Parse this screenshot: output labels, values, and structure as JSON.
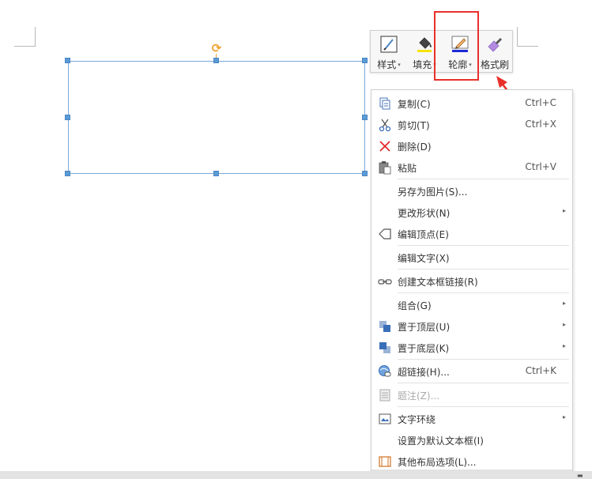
{
  "toolbar": {
    "items": [
      {
        "label": "样式",
        "caret": "▾",
        "icon": "style-icon"
      },
      {
        "label": "填充",
        "caret": "▾",
        "icon": "fill-bucket-icon"
      },
      {
        "label": "轮廓",
        "caret": "▾",
        "icon": "pencil-outline-icon"
      },
      {
        "label": "格式刷",
        "caret": "",
        "icon": "format-brush-icon"
      }
    ],
    "colors": {
      "fill_bar": "#f5e400",
      "outline_bar": "#1a2bd6",
      "brush": "#b28ae0"
    }
  },
  "annotation": {
    "highlight_color": "#e8302a"
  },
  "context_menu": {
    "items": [
      {
        "label": "复制(C)",
        "shortcut": "Ctrl+C",
        "icon": "copy-icon",
        "submenu": false,
        "disabled": false
      },
      {
        "label": "剪切(T)",
        "shortcut": "Ctrl+X",
        "icon": "scissors-icon",
        "submenu": false,
        "disabled": false
      },
      {
        "label": "删除(D)",
        "shortcut": "",
        "icon": "delete-x-icon",
        "submenu": false,
        "disabled": false
      },
      {
        "label": "粘贴",
        "shortcut": "Ctrl+V",
        "icon": "paste-icon",
        "submenu": false,
        "disabled": false
      },
      {
        "label": "另存为图片(S)...",
        "shortcut": "",
        "icon": "",
        "submenu": false,
        "disabled": false
      },
      {
        "label": "更改形状(N)",
        "shortcut": "",
        "icon": "",
        "submenu": true,
        "disabled": false
      },
      {
        "label": "编辑顶点(E)",
        "shortcut": "",
        "icon": "edit-points-icon",
        "submenu": false,
        "disabled": false
      },
      {
        "label": "编辑文字(X)",
        "shortcut": "",
        "icon": "",
        "submenu": false,
        "disabled": false
      },
      {
        "label": "创建文本框链接(R)",
        "shortcut": "",
        "icon": "link-chain-icon",
        "submenu": false,
        "disabled": false
      },
      {
        "label": "组合(G)",
        "shortcut": "",
        "icon": "",
        "submenu": true,
        "disabled": false
      },
      {
        "label": "置于顶层(U)",
        "shortcut": "",
        "icon": "bring-to-front-icon",
        "submenu": true,
        "disabled": false
      },
      {
        "label": "置于底层(K)",
        "shortcut": "",
        "icon": "send-to-back-icon",
        "submenu": true,
        "disabled": false
      },
      {
        "label": "超链接(H)...",
        "shortcut": "Ctrl+K",
        "icon": "hyperlink-globe-icon",
        "submenu": false,
        "disabled": false
      },
      {
        "label": "题注(Z)...",
        "shortcut": "",
        "icon": "caption-icon",
        "submenu": false,
        "disabled": true
      },
      {
        "label": "文字环绕",
        "shortcut": "",
        "icon": "text-wrap-icon",
        "submenu": true,
        "disabled": false
      },
      {
        "label": "设置为默认文本框(I)",
        "shortcut": "",
        "icon": "",
        "submenu": false,
        "disabled": false
      },
      {
        "label": "其他布局选项(L)...",
        "shortcut": "",
        "icon": "layout-options-icon",
        "submenu": false,
        "disabled": false
      }
    ],
    "scroll_glyph": "⌄"
  }
}
